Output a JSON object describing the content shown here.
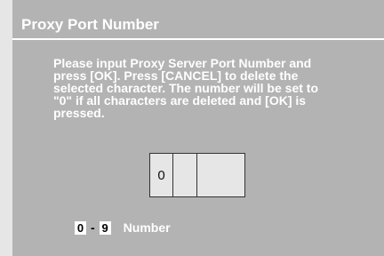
{
  "dialog": {
    "title": "Proxy Port Number",
    "message": "Please input Proxy Server Port Number and\npress [OK]. Press [CANCEL] to delete the\nselected character. The number will be set to\n\"0\" if all characters are deleted and [OK] is\npressed."
  },
  "entry": {
    "digits": [
      "0",
      "",
      ""
    ]
  },
  "key_hint": {
    "range_start": "0",
    "separator": "-",
    "range_end": "9",
    "description": "Number"
  }
}
